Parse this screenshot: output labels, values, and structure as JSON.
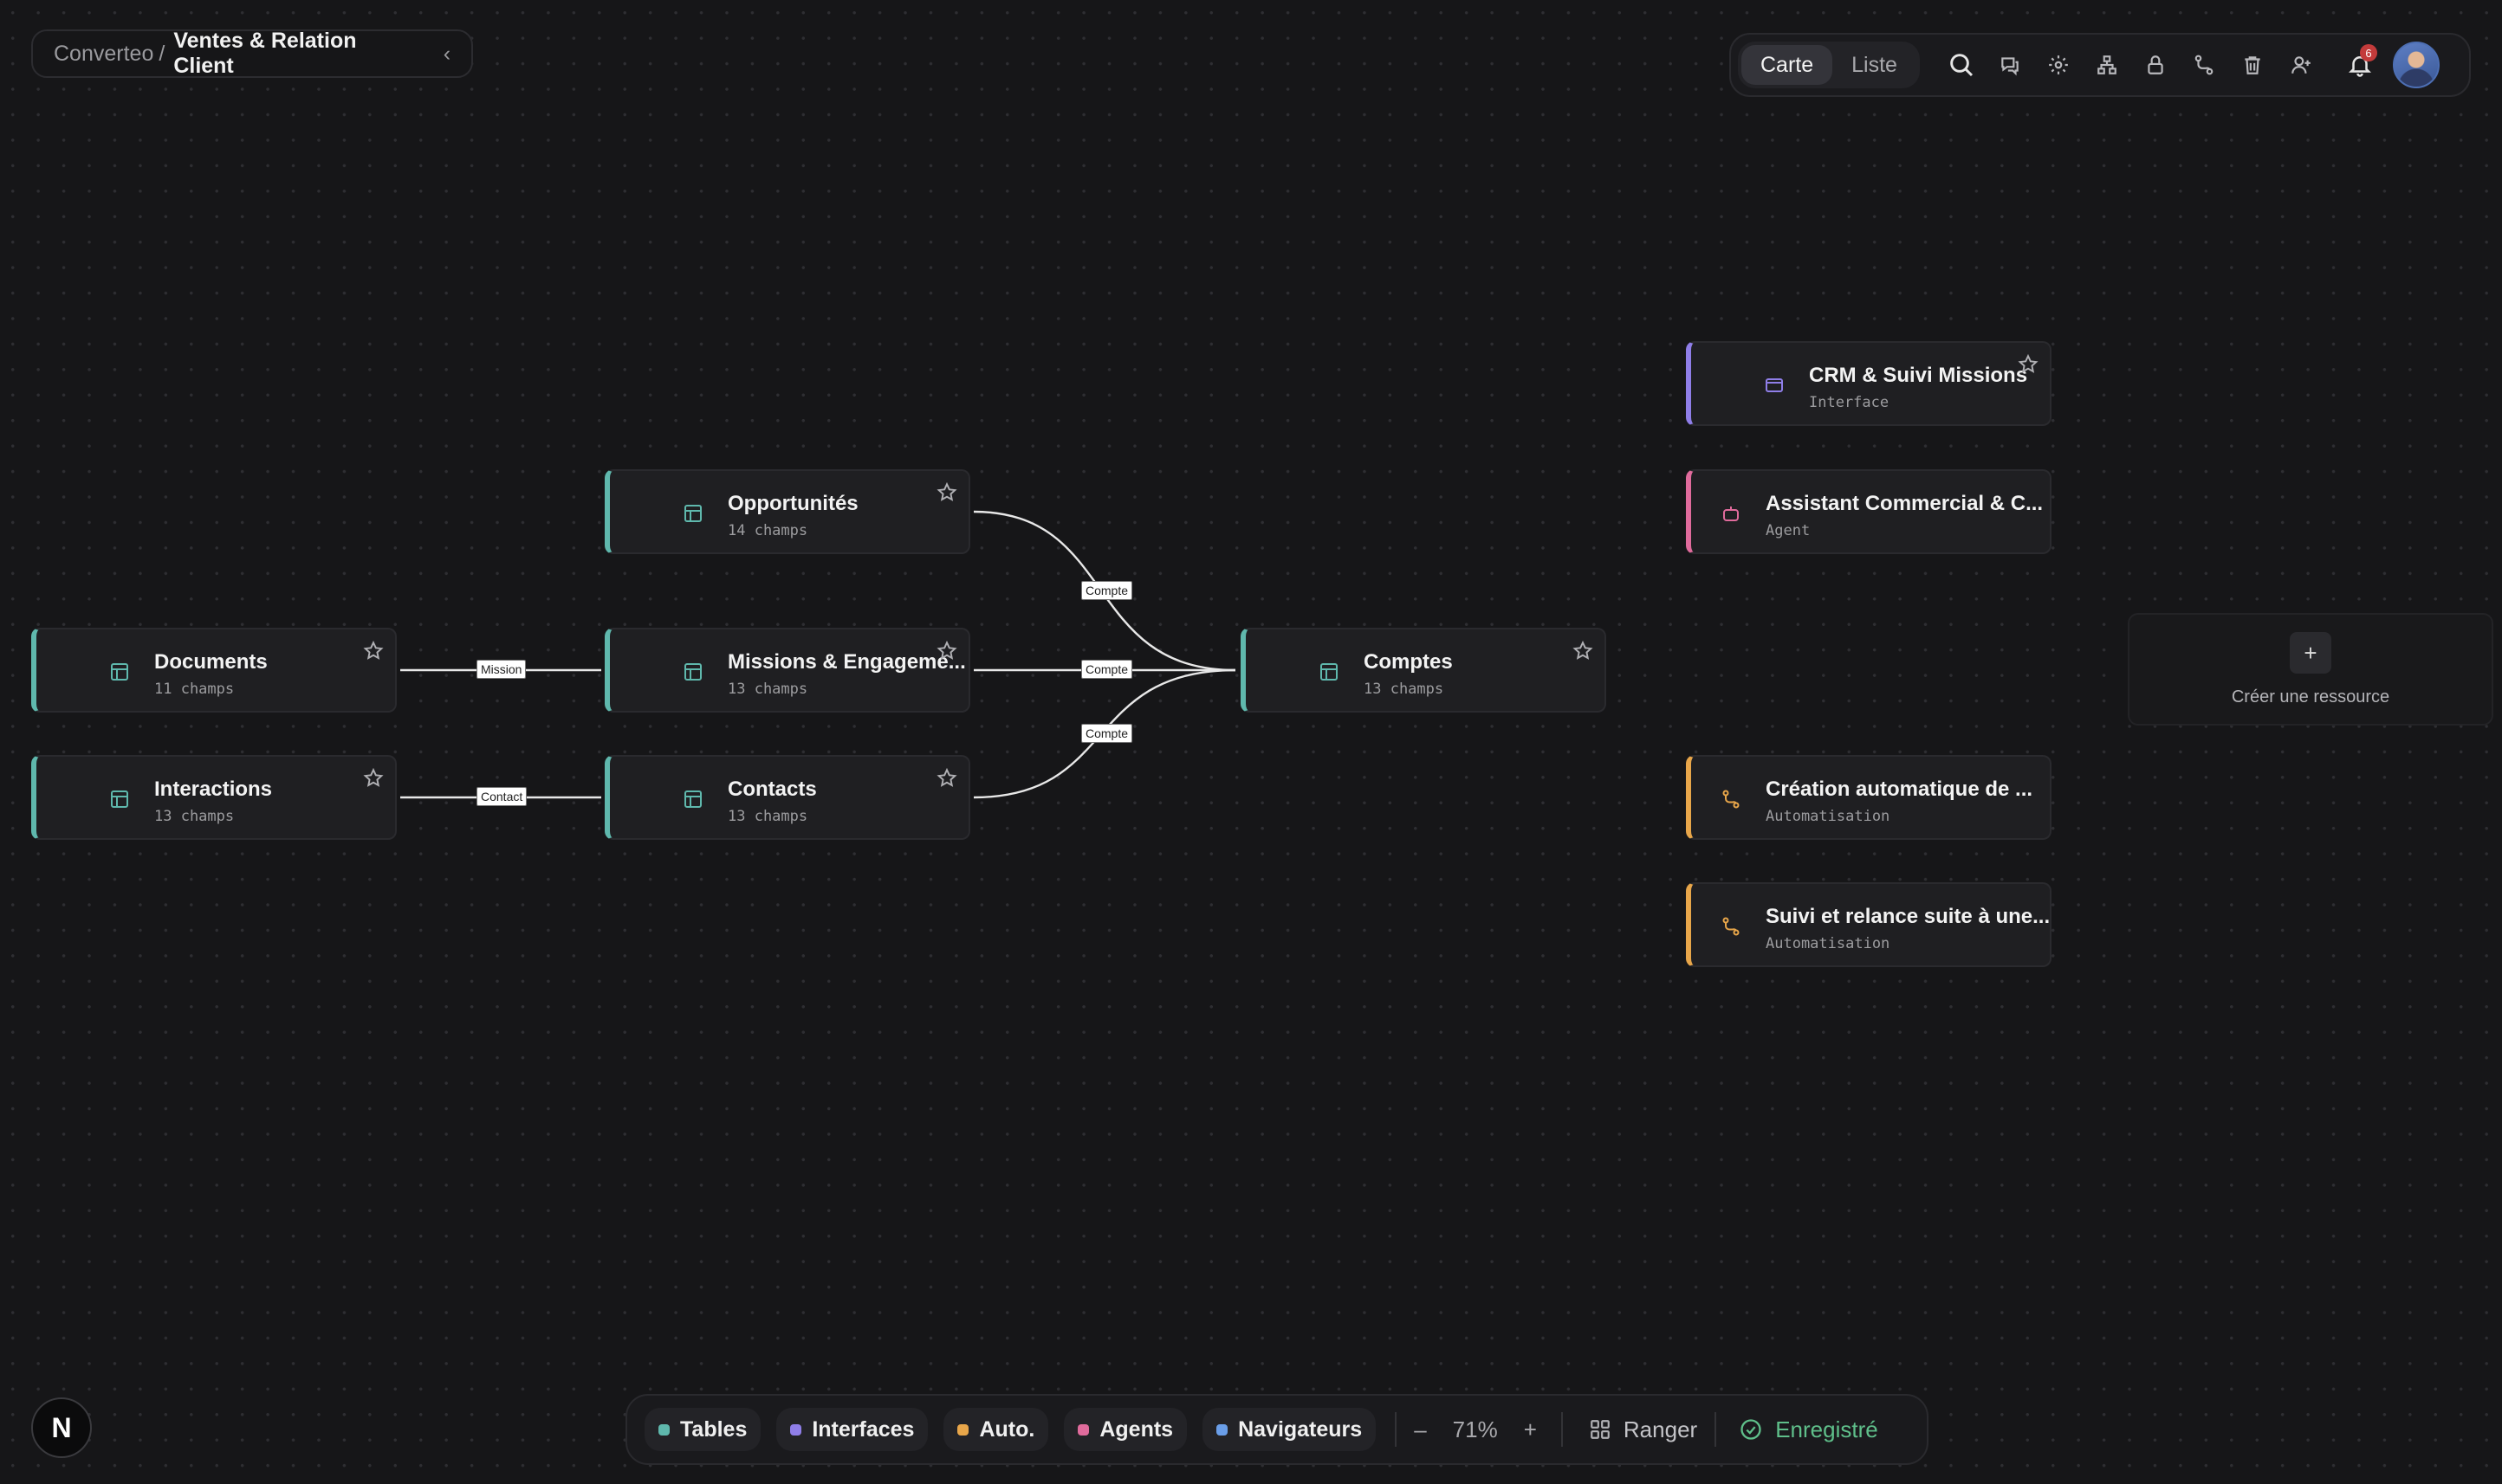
{
  "breadcrumb": {
    "org": "Converteo",
    "separator": "/",
    "current": "Ventes & Relation Client",
    "chevron": "‹"
  },
  "toolbar": {
    "view_tabs": [
      {
        "label": "Carte",
        "active": true
      },
      {
        "label": "Liste",
        "active": false
      }
    ],
    "icons": [
      "search-icon",
      "chat-icon",
      "gear-icon",
      "hierarchy-icon",
      "lock-icon",
      "route-icon",
      "trash-icon",
      "add-user-icon",
      "bell-icon",
      "avatar"
    ],
    "notification_count": "6"
  },
  "nodes": {
    "opportunites": {
      "title": "Opportunités",
      "sub": "14 champs"
    },
    "documents": {
      "title": "Documents",
      "sub": "11 champs"
    },
    "missions": {
      "title": "Missions & Engageme...",
      "sub": "13 champs"
    },
    "comptes": {
      "title": "Comptes",
      "sub": "13 champs"
    },
    "interactions": {
      "title": "Interactions",
      "sub": "13 champs"
    },
    "contacts": {
      "title": "Contacts",
      "sub": "13 champs"
    }
  },
  "resources": {
    "crm": {
      "title": "CRM & Suivi Missions",
      "sub": "Interface"
    },
    "assistant": {
      "title": "Assistant Commercial & C...",
      "sub": "Agent"
    },
    "creation": {
      "title": "Création automatique de ...",
      "sub": "Automatisation"
    },
    "suivi": {
      "title": "Suivi et relance suite à une...",
      "sub": "Automatisation"
    }
  },
  "edge_labels": {
    "doc_mission": "Mission",
    "inter_contact": "Contact",
    "opp_compte": "Compte",
    "mission_compte": "Compte",
    "contact_compte": "Compte"
  },
  "create": {
    "plus": "+",
    "label": "Créer une ressource"
  },
  "logo": "N",
  "bottombar": {
    "filters": [
      {
        "label": "Tables",
        "color": "#5fb8ad"
      },
      {
        "label": "Interfaces",
        "color": "#8f7ee8"
      },
      {
        "label": "Auto.",
        "color": "#e8a64a"
      },
      {
        "label": "Agents",
        "color": "#e06b9c"
      },
      {
        "label": "Navigateurs",
        "color": "#6a9ee8"
      }
    ],
    "zoom_minus": "–",
    "zoom_value": "71%",
    "zoom_plus": "+",
    "arrange_label": "Ranger",
    "saved_label": "Enregistré"
  }
}
